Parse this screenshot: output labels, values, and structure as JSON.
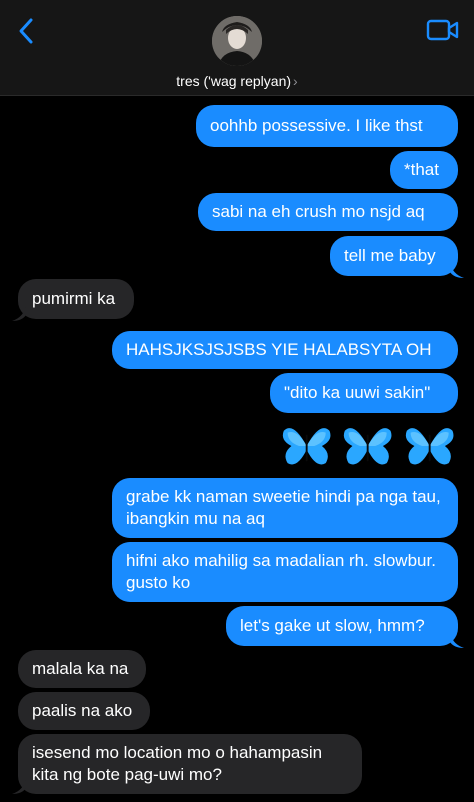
{
  "header": {
    "contact_name": "tres ('wag replyan)",
    "chevron": "›",
    "back_icon": "chevron-left-icon",
    "video_icon": "video-camera-icon",
    "accent": "#1a8cff"
  },
  "messages": [
    {
      "side": "sent",
      "text": "oohhb possessive. I like thst"
    },
    {
      "side": "sent",
      "text": "*that"
    },
    {
      "side": "sent",
      "text": "sabi na eh crush mo nsjd aq"
    },
    {
      "side": "sent",
      "text": "tell me baby"
    },
    {
      "side": "recv",
      "text": "pumirmi ka"
    },
    {
      "side": "sent",
      "text": "HAHSJKSJSJSBS YIE HALABSYTA OH"
    },
    {
      "side": "sent",
      "text": "\"dito ka uuwi sakin\""
    },
    {
      "side": "sent",
      "text": "grabe kk naman sweetie hindi pa nga tau, ibangkin mu na aq"
    },
    {
      "side": "sent",
      "text": "hifni ako mahilig sa madalian rh. slowbur. gusto ko"
    },
    {
      "side": "sent",
      "text": "let's gake ut slow, hmm?"
    },
    {
      "side": "recv",
      "text": "malala ka na"
    },
    {
      "side": "recv",
      "text": "paalis na ako"
    },
    {
      "side": "recv",
      "text": "isesend mo location mo o hahampasin kita ng bote pag-uwi mo?"
    }
  ],
  "emoji_message": {
    "icon": "blue-butterfly-icon",
    "count": 3
  },
  "colors": {
    "sent_bubble": "#1a8cff",
    "received_bubble": "#262628",
    "background": "#000000"
  }
}
